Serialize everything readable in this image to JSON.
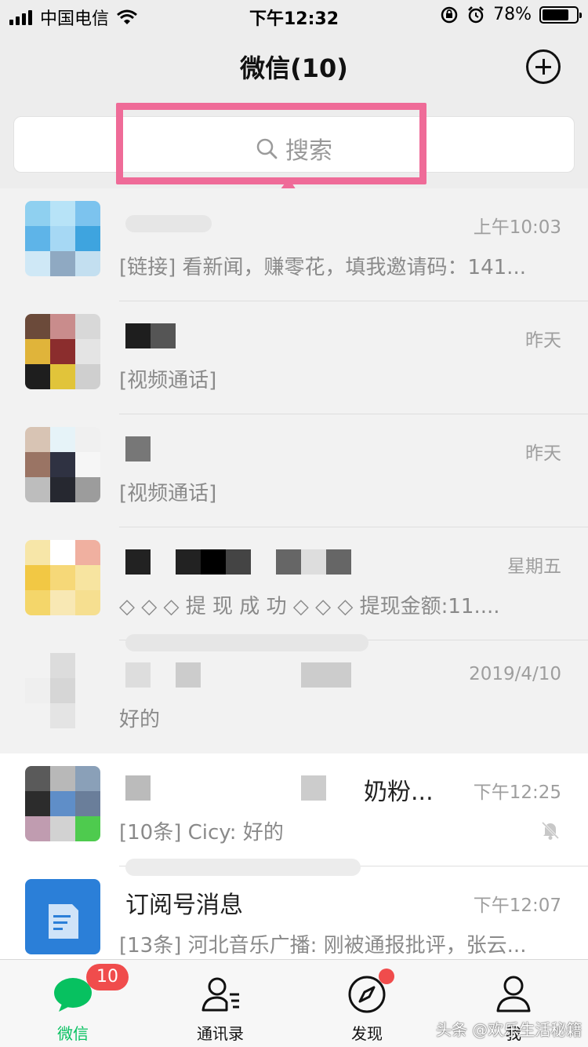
{
  "status_bar": {
    "carrier": "中国电信",
    "time": "下午12:32",
    "battery": "78%",
    "battery_level": 0.78
  },
  "header": {
    "title": "微信(10)",
    "add_icon": "plus-circle-icon"
  },
  "search": {
    "placeholder": "搜索",
    "highlight_color": "#ef6b98"
  },
  "chats": [
    {
      "time": "上午10:03",
      "preview": "[链接] 看新闻，赚零花，填我邀请码：141..."
    },
    {
      "time": "昨天",
      "preview": "[视频通话]"
    },
    {
      "time": "昨天",
      "preview": "[视频通话]"
    },
    {
      "time": "星期五",
      "preview": "◇ ◇ ◇ 提 现 成 功 ◇ ◇ ◇   提现金额:11...."
    },
    {
      "time": "2019/4/10",
      "preview": "好的"
    },
    {
      "name": "奶粉...",
      "time": "下午12:25",
      "preview": "[10条] Cicy: 好的",
      "muted": true
    },
    {
      "name": "订阅号消息",
      "time": "下午12:07",
      "preview": "[13条] 河北音乐广播: 刚被通报批评，张云..."
    }
  ],
  "tabs": [
    {
      "label": "微信",
      "icon": "chat-bubble-icon",
      "active": true,
      "badge": "10"
    },
    {
      "label": "通讯录",
      "icon": "contacts-icon"
    },
    {
      "label": "发现",
      "icon": "compass-icon",
      "dot": true
    },
    {
      "label": "我",
      "icon": "person-icon"
    }
  ],
  "watermark": "头条 @欢乐生活秘籍",
  "colors": {
    "accent": "#07c160",
    "badge": "#f04c4c"
  }
}
